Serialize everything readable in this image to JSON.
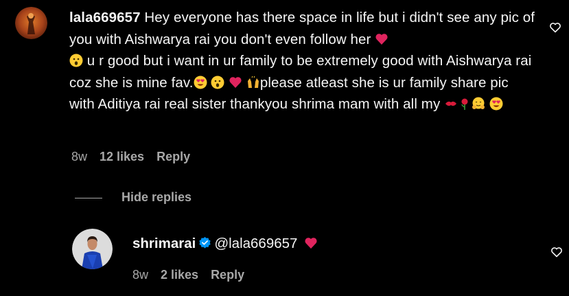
{
  "comment": {
    "username": "lala669657",
    "text_part1": " Hey everyone has there space in life but i didn't see any pic of you with Aishwarya rai you don't even follow her ",
    "text_part2": " u r good but i want in ur family to be extremely good with Aishwarya rai coz she is mine fav.",
    "text_part3": "please atleast she is ur family share pic with Aditiya rai real sister thankyou shrima mam with all my ",
    "time": "8w",
    "likes": "12 likes",
    "reply_label": "Reply"
  },
  "thread": {
    "hide_replies_label": "Hide replies"
  },
  "reply": {
    "username": "shrimarai",
    "mention": "@lala669657",
    "time": "8w",
    "likes": "2 likes",
    "reply_label": "Reply"
  },
  "icons": {
    "like": "heart-outline-icon",
    "verified": "verified-badge-icon"
  },
  "colors": {
    "background": "#000000",
    "text": "#f5f5f5",
    "secondary": "#a8a8a8",
    "verified": "#0095f6",
    "heart_red": "#e0245e"
  }
}
